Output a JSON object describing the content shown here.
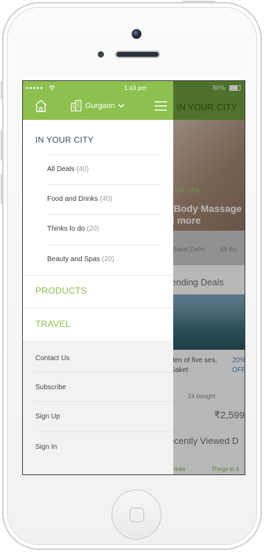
{
  "status_bar": {
    "signal": "●●●●●",
    "time": "1:43 pm",
    "battery": "80%"
  },
  "header": {
    "city": "Gurgaon",
    "accent_color": "#8dc04f"
  },
  "menu": {
    "city_heading": "IN YOUR CITY",
    "sub_items": [
      {
        "label": "All Deals",
        "count": "(40)"
      },
      {
        "label": "Food and Drinks",
        "count": "(40)"
      },
      {
        "label": "Thinks to do",
        "count": "(20)"
      },
      {
        "label": "Beauty and Spas",
        "count": "(20)"
      }
    ],
    "products": "PRODUCTS",
    "travel": "TRAVEL"
  },
  "footer": {
    "items": [
      "Contact Us",
      "Subscribe",
      "Sign Up",
      "Sign In"
    ]
  },
  "background": {
    "header_title": "IN YOUR CITY",
    "hero_tag": "VEN SPA",
    "hero_title": "l Body Massage d more",
    "location": "Saket,Delhi",
    "bought_count": "68 Bo",
    "trending_title": "ending Deals",
    "trend_name": "den of five ses, Saket",
    "trend_off": "20% OFF",
    "trend_bought": "24 bought",
    "trend_price": "₹2,599",
    "recent_title": "ecently Viewed D",
    "tab_food": "d Drinks",
    "tab_things": "Things to d"
  }
}
